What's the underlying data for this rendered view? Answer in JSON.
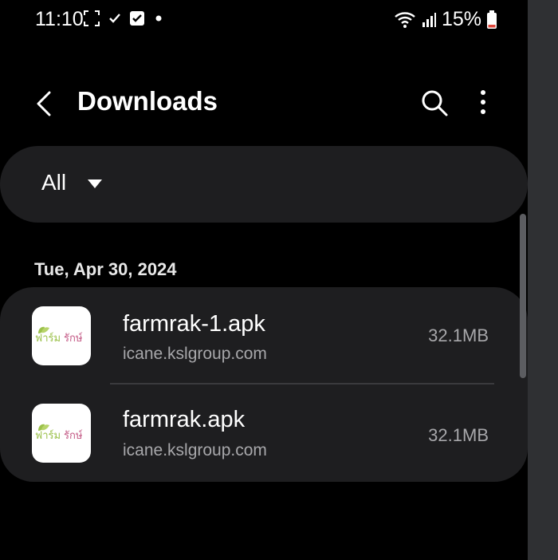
{
  "status_bar": {
    "time": "11:10",
    "battery_percent": "15%",
    "icons": [
      "screenshot-icon",
      "check-icon",
      "checkbox-icon",
      "dot-icon",
      "wifi-icon",
      "signal-icon",
      "battery-icon"
    ]
  },
  "header": {
    "title": "Downloads",
    "icons": [
      "back-icon",
      "search-icon",
      "more-options-icon"
    ]
  },
  "filter": {
    "selected": "All"
  },
  "section": {
    "date": "Tue, Apr 30, 2024"
  },
  "files": [
    {
      "name": "farmrak-1.apk",
      "source": "icane.kslgroup.com",
      "size": "32.1MB",
      "icon": "farmrak-app-icon"
    },
    {
      "name": "farmrak.apk",
      "source": "icane.kslgroup.com",
      "size": "32.1MB",
      "icon": "farmrak-app-icon"
    }
  ],
  "colors": {
    "background": "#000000",
    "surface": "#1e1e20",
    "secondary_text": "#a7a7aa",
    "logo_green": "#9bc14a",
    "logo_pink": "#c45a86"
  }
}
